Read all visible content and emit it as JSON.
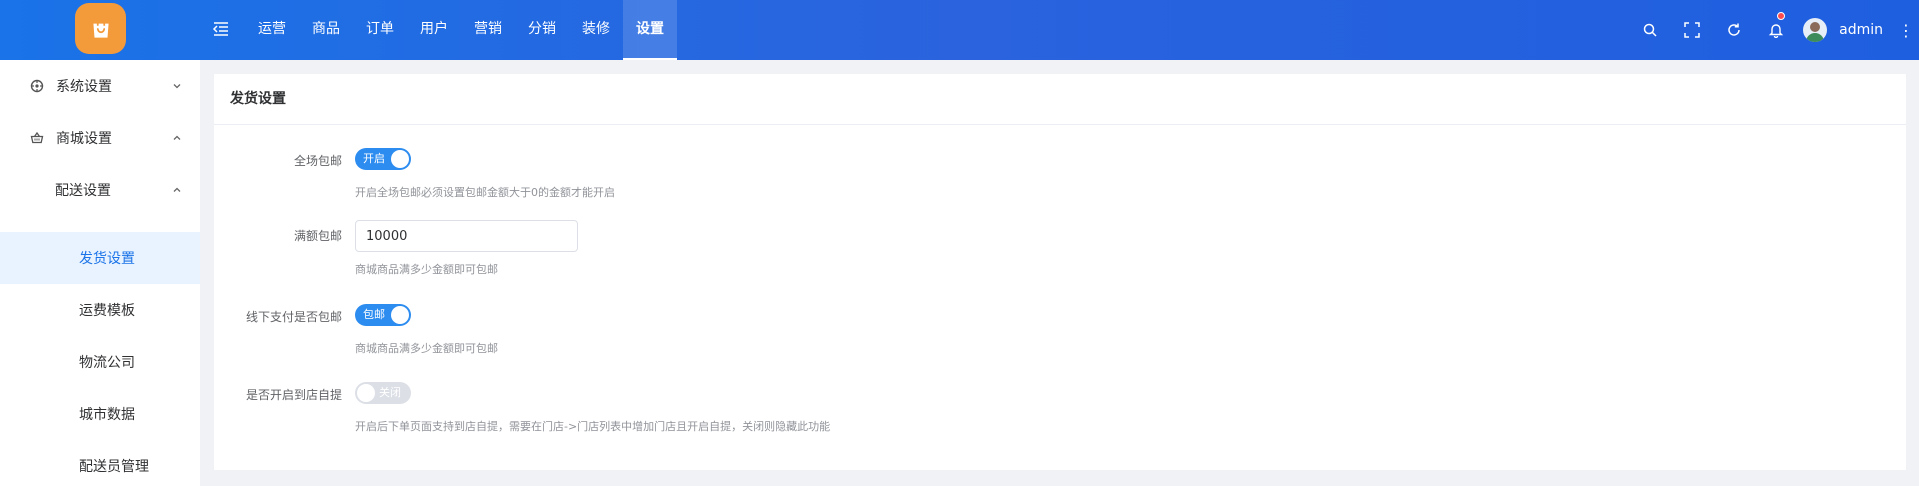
{
  "header": {
    "nav": [
      "运营",
      "商品",
      "订单",
      "用户",
      "营销",
      "分销",
      "装修",
      "设置"
    ],
    "active_index": 7,
    "user_name": "admin"
  },
  "sidebar": {
    "items": [
      {
        "label": "系统设置",
        "level": 1,
        "icon": "dashboard-icon"
      },
      {
        "label": "商城设置",
        "level": 1,
        "icon": "basket-icon"
      },
      {
        "label": "配送设置",
        "level": 2
      },
      {
        "label": "发货设置",
        "level": 3,
        "active": true
      },
      {
        "label": "运费模板",
        "level": 3
      },
      {
        "label": "物流公司",
        "level": 3
      },
      {
        "label": "城市数据",
        "level": 3
      },
      {
        "label": "配送员管理",
        "level": 3
      }
    ]
  },
  "main": {
    "title": "发货设置",
    "fields": {
      "free_all": {
        "label": "全场包邮",
        "switch_text": "开启",
        "on": true,
        "hint": "开启全场包邮必须设置包邮金额大于0的金额才能开启"
      },
      "full_amount": {
        "label": "满额包邮",
        "value": "10000",
        "hint": "商城商品满多少金额即可包邮"
      },
      "offline_pay": {
        "label": "线下支付是否包邮",
        "switch_text": "包邮",
        "on": true,
        "hint": "商城商品满多少金额即可包邮"
      },
      "store_pickup": {
        "label": "是否开启到店自提",
        "switch_text": "关闭",
        "on": false,
        "hint": "开启后下单页面支持到店自提，需要在门店->门店列表中增加门店且开启自提，关闭则隐藏此功能"
      }
    }
  },
  "colors": {
    "primary": "#2d8cf0",
    "header": "#1a73e8",
    "logo": "#f39a3a"
  }
}
